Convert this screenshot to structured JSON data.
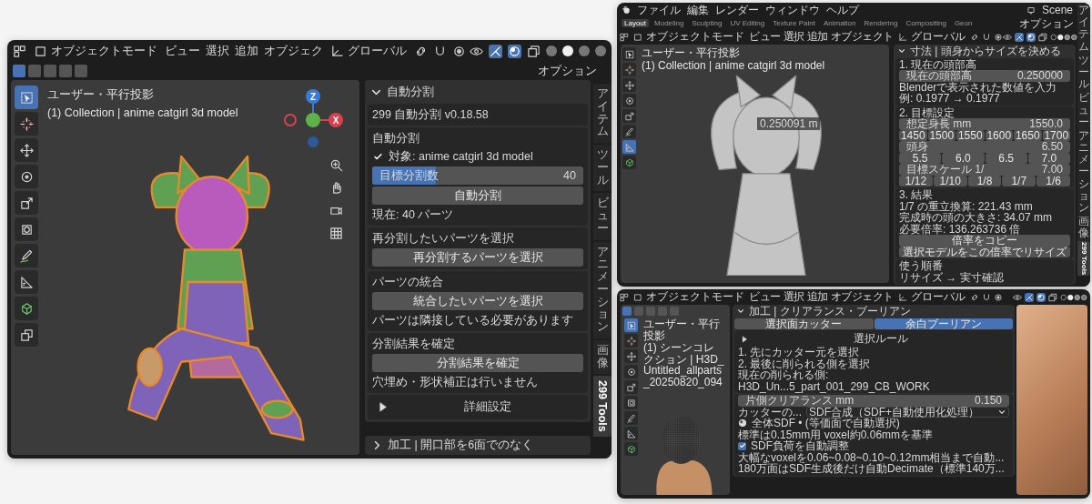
{
  "main_window": {
    "header": {
      "mode": "オブジェクトモード",
      "menus": [
        "ビュー",
        "選択",
        "追加",
        "オブジェク"
      ],
      "orientation": "グローバル",
      "shading": [
        {
          "selected": false
        },
        {
          "selected": true
        },
        {
          "selected": false
        },
        {
          "selected": false
        }
      ]
    },
    "select_modes": [
      {
        "selected": true
      },
      {
        "selected": false
      },
      {
        "selected": false
      },
      {
        "selected": false
      },
      {
        "selected": false
      }
    ],
    "options": "オプション",
    "tools": [
      {
        "kind": "select",
        "selected": true
      },
      {
        "kind": "cursor",
        "selected": false
      },
      {
        "kind": "move",
        "selected": false
      },
      {
        "kind": "rotate",
        "selected": false
      },
      {
        "kind": "scale",
        "selected": false
      },
      {
        "kind": "transform",
        "selected": false
      },
      {
        "kind": "annotate",
        "selected": false
      },
      {
        "kind": "measure",
        "selected": false
      },
      {
        "kind": "cube",
        "selected": false
      },
      {
        "kind": "cubes",
        "selected": false
      }
    ],
    "viewport": {
      "view_name": "ユーザー・平行投影",
      "collection": "(1) Collection | anime catgirl 3d model",
      "gizmo": {
        "z": "Z",
        "x": "X"
      }
    },
    "panel": {
      "title": "自動分割",
      "expanded": true,
      "version": "299 自動分割 v0.18.58",
      "sections": [
        {
          "items": [
            {
              "kind": "heading",
              "text": "自動分割"
            },
            {
              "kind": "check",
              "text": "対象: anime catgirl 3d model",
              "checked": true
            },
            {
              "kind": "slider",
              "label": "目標分割数",
              "value": "40",
              "level": 0.3
            },
            {
              "kind": "button",
              "text": "自動分割"
            },
            {
              "kind": "text",
              "text": "現在: 40 パーツ"
            }
          ]
        },
        {
          "items": [
            {
              "kind": "heading",
              "text": "再分割したいパーツを選択"
            },
            {
              "kind": "button",
              "text": "再分割するパーツを選択"
            }
          ]
        },
        {
          "items": [
            {
              "kind": "heading",
              "text": "パーツの統合"
            },
            {
              "kind": "button",
              "text": "統合したいパーツを選択"
            },
            {
              "kind": "text",
              "text": "パーツは隣接している必要があります"
            }
          ]
        },
        {
          "items": [
            {
              "kind": "heading",
              "text": "分割結果を確定"
            },
            {
              "kind": "button",
              "text": "分割結果を確定"
            },
            {
              "kind": "text",
              "text": "穴埋め・形状補正は行いません"
            }
          ]
        },
        {
          "items": [
            {
              "kind": "disclosure",
              "text": "詳細設定",
              "expanded": false
            }
          ]
        }
      ]
    },
    "next_panel": {
      "title": "加工 | 開口部を6面でのなく",
      "expanded": false
    },
    "tabs": [
      {
        "label": "アイテム",
        "kind": "stacked",
        "selected": false
      },
      {
        "label": "ツール",
        "kind": "stacked",
        "selected": false
      },
      {
        "label": "ビュー",
        "kind": "stacked",
        "selected": false
      },
      {
        "label": "アニメーション",
        "kind": "stacked",
        "selected": false
      },
      {
        "label": "画像",
        "kind": "stacked",
        "selected": false
      },
      {
        "label": "299 Tools",
        "kind": "rotated",
        "selected": true
      }
    ]
  },
  "top_right_window": {
    "menus": [
      "ファイル",
      "編集",
      "レンダー",
      "ウィンドウ",
      "ヘルプ"
    ],
    "workspaces": [
      {
        "label": "Layout",
        "selected": true
      },
      {
        "label": "Modeling",
        "selected": false
      },
      {
        "label": "Sculpting",
        "selected": false
      },
      {
        "label": "UV Editing",
        "selected": false
      },
      {
        "label": "Texture Paint",
        "selected": false
      },
      {
        "label": "Animation",
        "selected": false
      },
      {
        "label": "Rendering",
        "selected": false
      },
      {
        "label": "Compositing",
        "selected": false
      },
      {
        "label": "Geon",
        "selected": false
      }
    ],
    "scene": "Scene",
    "header": {
      "mode": "オブジェクトモード",
      "menus": [
        "ビュー",
        "選択",
        "追加",
        "オブジェクト"
      ],
      "orientation": "グローバル"
    },
    "options": "オプション",
    "tools": [
      {
        "kind": "select",
        "selected": false
      },
      {
        "kind": "cursor",
        "selected": false
      },
      {
        "kind": "move",
        "selected": false
      },
      {
        "kind": "rotate",
        "selected": false
      },
      {
        "kind": "scale",
        "selected": false
      },
      {
        "kind": "annotate",
        "selected": false
      },
      {
        "kind": "measure",
        "selected": true
      },
      {
        "kind": "cube",
        "selected": false
      }
    ],
    "viewport": {
      "view_name": "ユーザー・平行投影",
      "collection": "(1) Collection | anime catgirl 3d model",
      "measure": "0.250091 m"
    },
    "panel": {
      "title": "寸法 | 頭身からサイズを決める",
      "expanded": true,
      "sections": [
        {
          "items": [
            {
              "kind": "heading",
              "text": "1. 現在の頭部高"
            },
            {
              "kind": "field",
              "label": "現在の頭部高",
              "value": "0.250000"
            },
            {
              "kind": "text",
              "text": "Blenderで表示された数値を入力"
            },
            {
              "kind": "text",
              "text": "例: 0.1977 → 0.1977"
            }
          ]
        },
        {
          "items": [
            {
              "kind": "heading",
              "text": "2. 目標設定"
            },
            {
              "kind": "field",
              "label": "想定身長 mm",
              "value": "1550.0"
            },
            {
              "kind": "choices",
              "options": [
                "1450",
                "1500",
                "1550",
                "1600",
                "1650",
                "1700"
              ]
            },
            {
              "kind": "field",
              "label": "頭身",
              "value": "6.50"
            },
            {
              "kind": "choices",
              "options": [
                "5.5",
                "6.0",
                "6.5",
                "7.0"
              ]
            },
            {
              "kind": "field",
              "label": "目標スケール 1/",
              "value": "7.00"
            },
            {
              "kind": "choices",
              "options": [
                "1/12",
                "1/10",
                "1/8",
                "1/7",
                "1/6"
              ]
            }
          ]
        },
        {
          "items": [
            {
              "kind": "heading",
              "text": "3. 結果"
            },
            {
              "kind": "text",
              "text": "1/7 の重立換算: 221.43 mm"
            },
            {
              "kind": "text",
              "text": "完成時の頭の大きさ: 34.07 mm"
            },
            {
              "kind": "text",
              "text": "必要倍率: 136.263736 倍"
            },
            {
              "kind": "button",
              "text": "倍率をコピー"
            },
            {
              "kind": "button",
              "text": "選択モデルをこの倍率でリサイズ"
            }
          ]
        },
        {
          "items": [
            {
              "kind": "heading",
              "text": "使う順番"
            },
            {
              "kind": "text",
              "text": "リサイズ → 実寸確認"
            }
          ]
        }
      ]
    },
    "tabs": [
      {
        "label": "アイテム",
        "kind": "stacked",
        "selected": false
      },
      {
        "label": "ツール",
        "kind": "stacked",
        "selected": false
      },
      {
        "label": "ビュー",
        "kind": "stacked",
        "selected": false
      },
      {
        "label": "アニメーション",
        "kind": "stacked",
        "selected": false
      },
      {
        "label": "画像",
        "kind": "stacked",
        "selected": false
      },
      {
        "label": "299 Tools",
        "kind": "rotated",
        "selected": true
      }
    ]
  },
  "bottom_right_window": {
    "header": {
      "mode": "オブジェクトモード",
      "menus": [
        "ビュー",
        "選択",
        "追加",
        "オブジェクト"
      ],
      "orientation": "グローバル"
    },
    "select_modes": [
      {
        "selected": true
      },
      {
        "selected": false
      },
      {
        "selected": false
      },
      {
        "selected": false
      },
      {
        "selected": false
      }
    ],
    "tools": [
      {
        "kind": "select",
        "selected": true
      },
      {
        "kind": "cursor",
        "selected": false
      },
      {
        "kind": "move",
        "selected": false
      },
      {
        "kind": "rotate",
        "selected": false
      },
      {
        "kind": "scale",
        "selected": false
      },
      {
        "kind": "transform",
        "selected": false
      },
      {
        "kind": "annotate",
        "selected": false
      },
      {
        "kind": "measure",
        "selected": false
      },
      {
        "kind": "cube",
        "selected": false
      }
    ],
    "viewport": {
      "view_name": "ユーザー・平行投影",
      "collection": "(1) シーンコレクション | H3D_Untitled_allparts_20250820_094"
    },
    "panel": {
      "title": "加工 | クリアランス・ブーリアン",
      "expanded": true,
      "items": [
        {
          "kind": "segmented",
          "options": [
            {
              "label": "選択面カッター",
              "selected": false
            },
            {
              "label": "余白ブーリアン",
              "selected": true
            }
          ]
        }
      ],
      "sections": [
        {
          "items": [
            {
              "kind": "disclosure",
              "text": "選択ルール",
              "expanded": false
            },
            {
              "kind": "text",
              "text": "1. 先にカッター元を選択"
            },
            {
              "kind": "text",
              "text": "2. 最後に削られる側を選択"
            },
            {
              "kind": "text",
              "text": "現在の削られる側: H3D_Un...5_part_001_299_CB_WORK"
            }
          ]
        },
        {
          "items": [
            {
              "kind": "field",
              "label": "片側クリアランス mm",
              "value": "0.150"
            },
            {
              "kind": "dropdown",
              "label": "カッターの...",
              "value": "SDF合成（SDF+自動使用化処理）"
            },
            {
              "kind": "icon_text",
              "text": "全体SDF • (等価面で自動選択)"
            },
            {
              "kind": "text",
              "text": "標準は0.15mm用 voxel約0.06mmを基準"
            },
            {
              "kind": "check",
              "text": "SDF負荷を自動調整",
              "checked": true
            },
            {
              "kind": "text",
              "text": "大幅なvoxelを0.06~0.08~0.10~0.12mm相当まで自動..."
            },
            {
              "kind": "text",
              "text": "180万面はSDF生成後だけ自動Decimate（標準140万..."
            }
          ]
        }
      ]
    }
  }
}
